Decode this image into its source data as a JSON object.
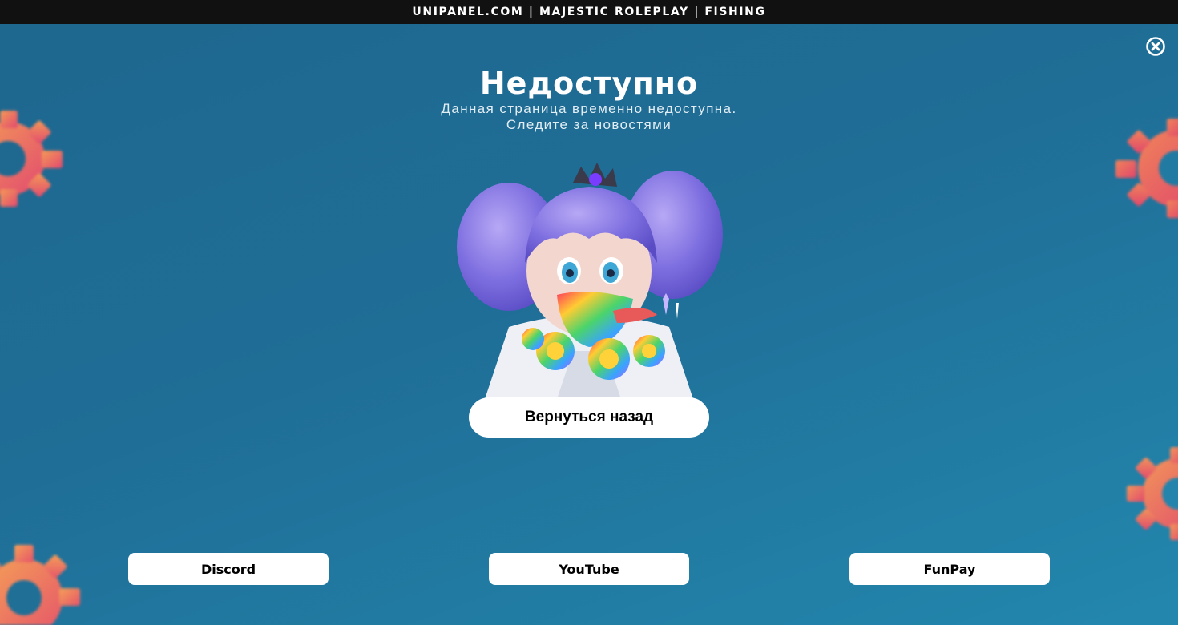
{
  "header": {
    "title": "UNIPANEL.COM | MAJESTIC ROLEPLAY | FISHING"
  },
  "page": {
    "title": "Недоступно",
    "subtitle_line1": "Данная страница временно недоступна.",
    "subtitle_line2": "Следите за новостями"
  },
  "actions": {
    "back_label": "Вернуться назад"
  },
  "social": {
    "links": [
      {
        "label": "Discord"
      },
      {
        "label": "YouTube"
      },
      {
        "label": "FunPay"
      }
    ]
  },
  "icons": {
    "close": "close-circle-icon",
    "gear": "gear-icon"
  },
  "colors": {
    "background": "#1f6e97",
    "topbar": "#111111",
    "gear": "#e8506a"
  }
}
